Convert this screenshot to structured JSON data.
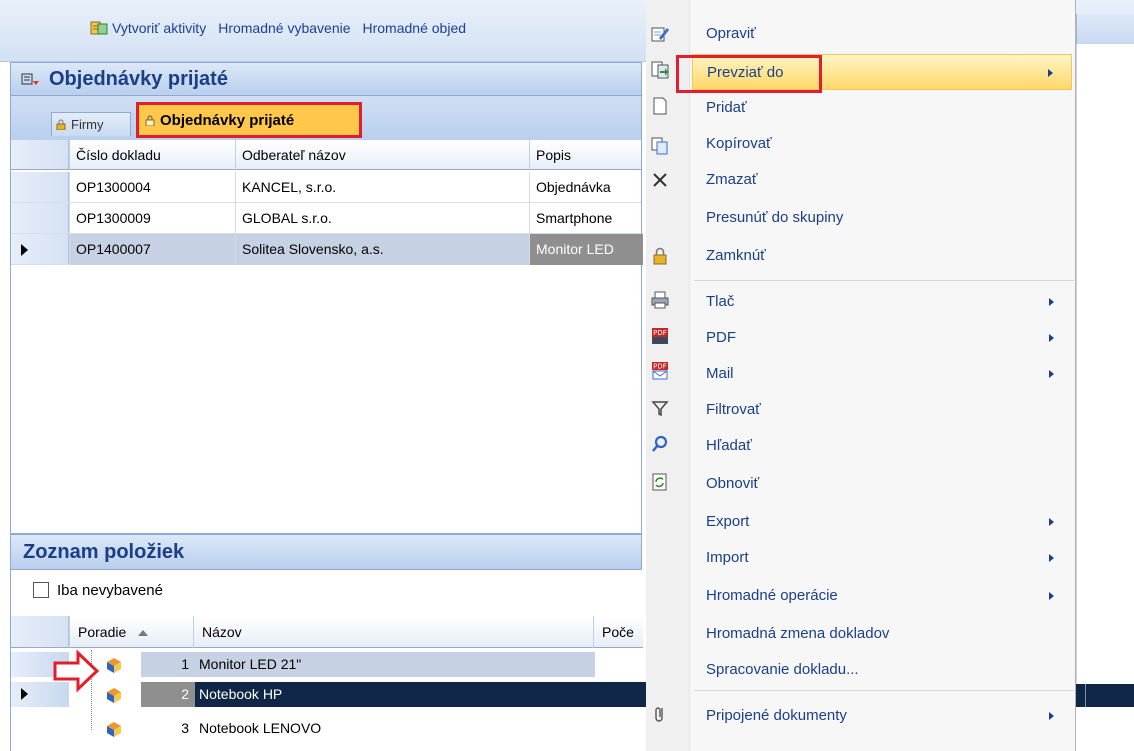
{
  "toolbar": {
    "items": [
      {
        "label": "Vytvoriť aktivity",
        "icon": "create-activities-icon"
      },
      {
        "label": "Hromadné vybavenie"
      },
      {
        "label": "Hromadné objed"
      }
    ]
  },
  "module": {
    "title": "Objednávky prijaté",
    "icon": "orders-received-icon",
    "tabs": [
      {
        "label": "Firmy",
        "icon": "lock-icon"
      },
      {
        "label": "Objednávky prijaté",
        "icon": "lock-icon"
      }
    ]
  },
  "orders_grid": {
    "columns": [
      "Číslo dokladu",
      "Odberateľ názov",
      "Popis"
    ],
    "rows": [
      {
        "cislo": "OP1300004",
        "odberatel": "KANCEL, s.r.o.",
        "popis": "Objednávka"
      },
      {
        "cislo": "OP1300009",
        "odberatel": "GLOBAL s.r.o.",
        "popis": "Smartphone"
      },
      {
        "cislo": "OP1400007",
        "odberatel": "Solitea Slovensko, a.s.",
        "popis": "Monitor LED"
      }
    ]
  },
  "items_section": {
    "title": "Zoznam položiek",
    "filter_label": "Iba nevybavené",
    "filter_checked": false,
    "columns": [
      "Poradie",
      "Názov",
      "Poče"
    ],
    "rows": [
      {
        "poradie": "1",
        "nazov": "Monitor LED 21\""
      },
      {
        "poradie": "2",
        "nazov": "Notebook HP"
      },
      {
        "poradie": "3",
        "nazov": "Notebook LENOVO"
      }
    ]
  },
  "context_menu": {
    "items": [
      {
        "label": "Opraviť",
        "icon": "edit-icon"
      },
      {
        "label": "Prevziať do",
        "icon": "transfer-icon",
        "submenu": true,
        "highlighted": true
      },
      {
        "label": "Pridať",
        "icon": "new-document-icon"
      },
      {
        "label": "Kopírovať",
        "icon": "copy-icon"
      },
      {
        "label": "Zmazať",
        "icon": "delete-icon"
      },
      {
        "label": "Presunúť do skupiny"
      },
      {
        "label": "Zamknúť",
        "icon": "lock-icon"
      },
      {
        "label": "Tlač",
        "icon": "printer-icon",
        "submenu": true
      },
      {
        "label": "PDF",
        "icon": "pdf-icon",
        "submenu": true
      },
      {
        "label": "Mail",
        "icon": "pdf-mail-icon",
        "submenu": true
      },
      {
        "label": "Filtrovať",
        "icon": "filter-icon"
      },
      {
        "label": "Hľadať",
        "icon": "search-icon"
      },
      {
        "label": "Obnoviť",
        "icon": "refresh-icon"
      },
      {
        "label": "Export",
        "submenu": true
      },
      {
        "label": "Import",
        "submenu": true
      },
      {
        "label": "Hromadné operácie",
        "submenu": true
      },
      {
        "label": "Hromadná zmena dokladov"
      },
      {
        "label": "Spracovanie dokladu..."
      },
      {
        "label": "Pripojené dokumenty",
        "icon": "attachment-icon",
        "submenu": true
      }
    ]
  },
  "colors": {
    "accent_blue": "#1b3f86",
    "highlight": "#ffd868",
    "annotation_red": "#e11d2e",
    "selected_row_dark": "#0f2646"
  }
}
